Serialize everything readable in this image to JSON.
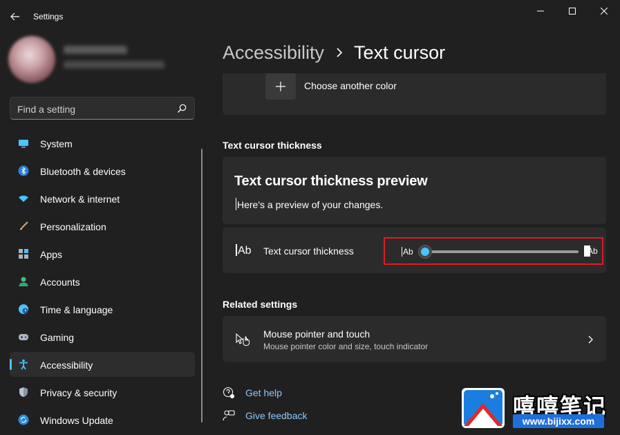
{
  "window": {
    "title": "Settings"
  },
  "search": {
    "placeholder": "Find a setting"
  },
  "sidebar": {
    "items": [
      {
        "label": "System",
        "icon": "system-icon",
        "active": false
      },
      {
        "label": "Bluetooth & devices",
        "icon": "bluetooth-icon",
        "active": false
      },
      {
        "label": "Network & internet",
        "icon": "wifi-icon",
        "active": false
      },
      {
        "label": "Personalization",
        "icon": "brush-icon",
        "active": false
      },
      {
        "label": "Apps",
        "icon": "apps-icon",
        "active": false
      },
      {
        "label": "Accounts",
        "icon": "person-icon",
        "active": false
      },
      {
        "label": "Time & language",
        "icon": "globe-clock-icon",
        "active": false
      },
      {
        "label": "Gaming",
        "icon": "gamepad-icon",
        "active": false
      },
      {
        "label": "Accessibility",
        "icon": "accessibility-icon",
        "active": true
      },
      {
        "label": "Privacy & security",
        "icon": "shield-icon",
        "active": false
      },
      {
        "label": "Windows Update",
        "icon": "update-icon",
        "active": false
      }
    ]
  },
  "breadcrumb": {
    "parent": "Accessibility",
    "current": "Text cursor"
  },
  "color_section": {
    "choose_label": "Choose another color"
  },
  "thickness_section": {
    "heading": "Text cursor thickness",
    "preview_title": "Text cursor thickness preview",
    "preview_text": "Here's a preview of your changes.",
    "setting_label": "Text cursor thickness",
    "icon_text": "Ab",
    "slider_min_label": "Ab",
    "slider_max_label": "Ab",
    "slider_value_fraction": 0.0
  },
  "related_settings": {
    "heading": "Related settings",
    "items": [
      {
        "title": "Mouse pointer and touch",
        "subtitle": "Mouse pointer color and size, touch indicator"
      }
    ]
  },
  "links": {
    "get_help": "Get help",
    "give_feedback": "Give feedback"
  },
  "watermark": {
    "chinese_text": "嘻嘻笔记",
    "url": "www.bijixx.com"
  },
  "colors": {
    "background": "#202020",
    "card": "#2b2b2b",
    "accent": "#4cc2ff",
    "highlight_box": "#e01b24",
    "link": "#8fc8ff"
  }
}
